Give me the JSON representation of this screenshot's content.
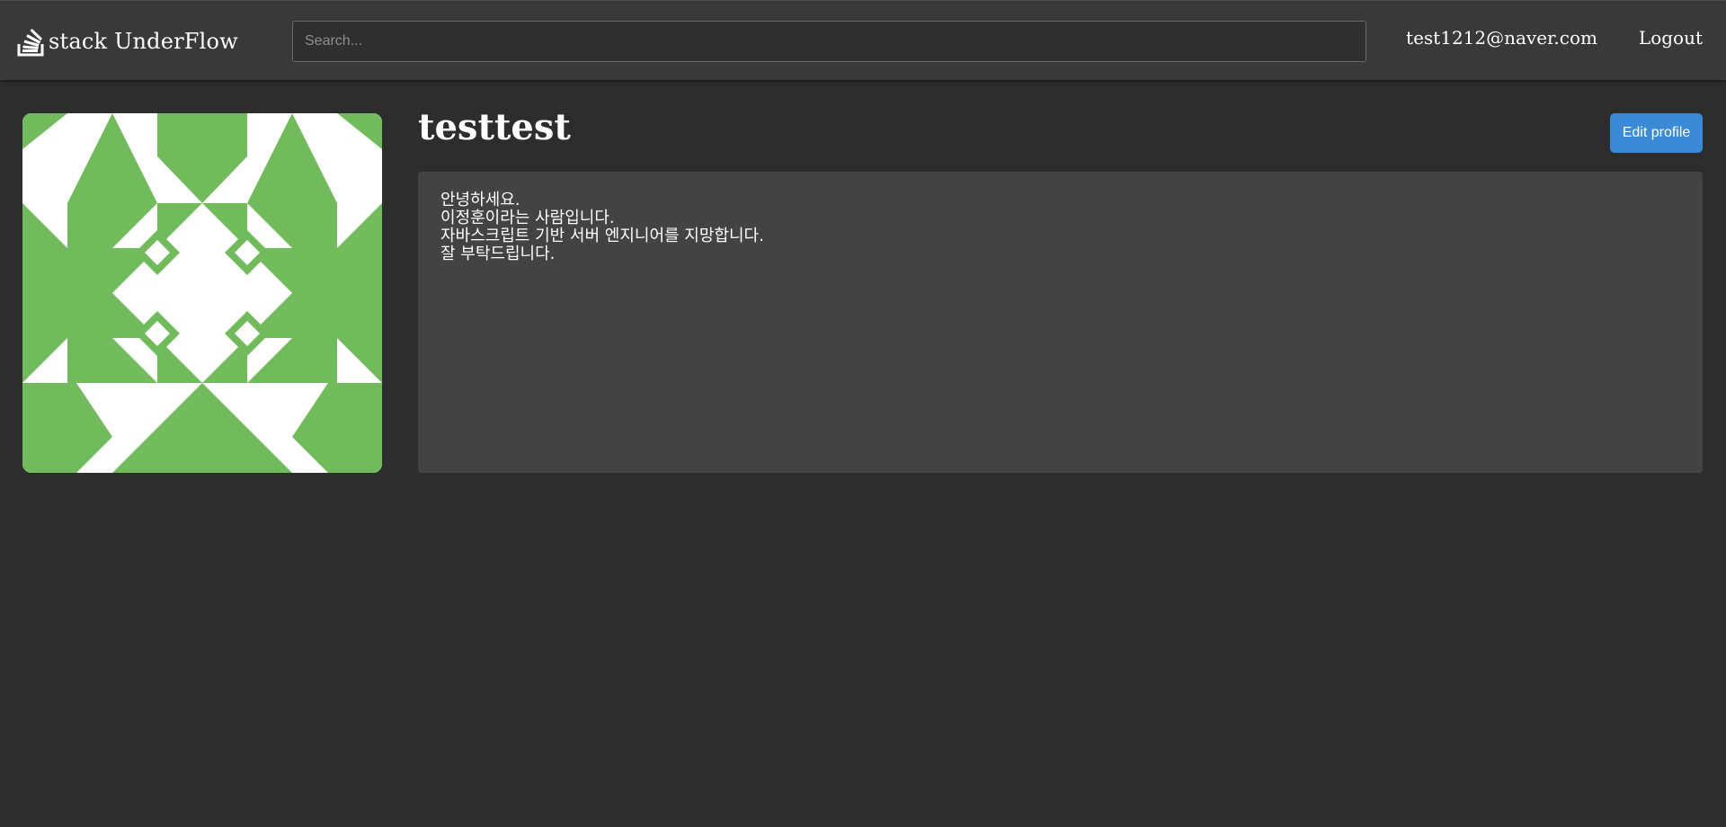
{
  "header": {
    "logo_text": "stack UnderFlow",
    "logo_icon": "stack-logo-icon",
    "search_placeholder": "Search...",
    "user_email": "test1212@naver.com",
    "logout_label": "Logout"
  },
  "profile": {
    "username": "testtest",
    "edit_label": "Edit profile",
    "avatar_icon": "identicon-avatar",
    "bio_lines": [
      "안녕하세요.",
      "이정훈이라는 사람입니다.",
      "자바스크립트 기반 서버 엔지니어를 지망합니다.",
      "잘 부탁드립니다."
    ]
  },
  "colors": {
    "page_background": "#2d2d2d",
    "header_background": "#393939",
    "bio_background": "#434343",
    "button_blue": "#3a8ad8",
    "avatar_green": "#72bb5c"
  }
}
